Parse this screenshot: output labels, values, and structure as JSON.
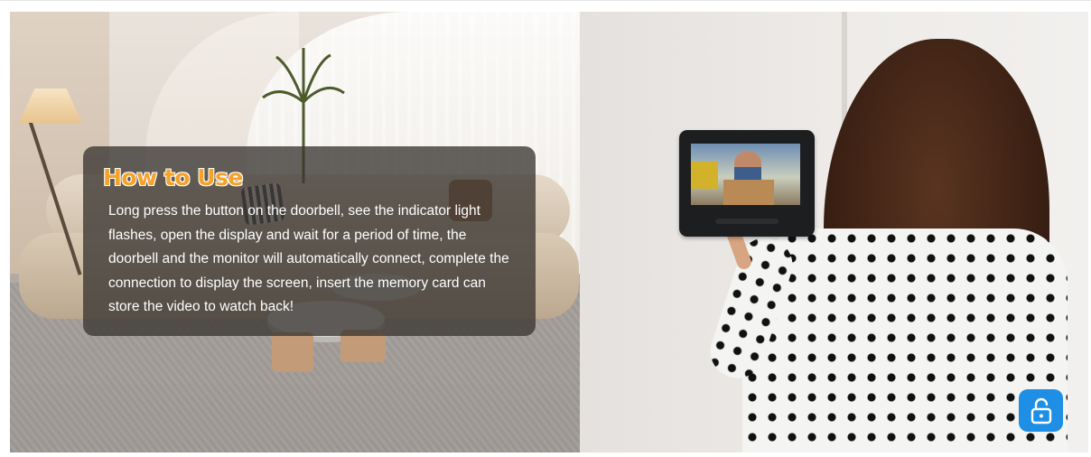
{
  "section": {
    "title": "How to Use",
    "body": "Long press the button on the doorbell, see the indicator light flashes, open the display and wait for a period of time, the doorbell and the monitor will automatically connect, complete the connection to display the screen, insert the memory card can store the video to watch back!"
  },
  "colors": {
    "title_orange": "#f5a22a",
    "overlay": "#3a3632",
    "lock_button": "#1e8fe4"
  },
  "icons": {
    "lock": "unlock-icon"
  }
}
